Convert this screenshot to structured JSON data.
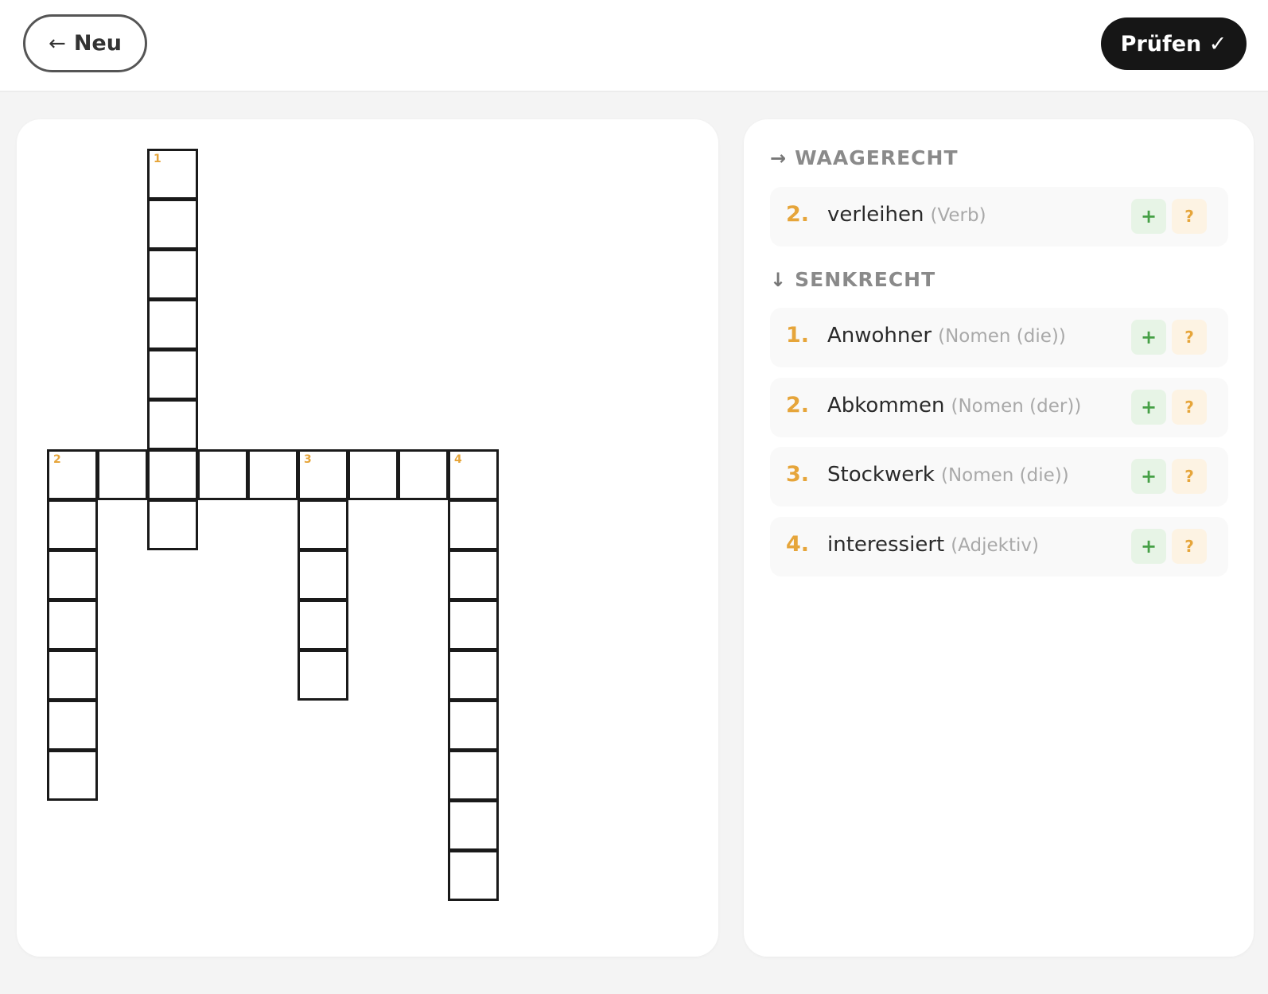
{
  "header": {
    "back_label": "Neu",
    "back_icon": "arrow-left-icon",
    "check_label": "Prüfen ✓"
  },
  "crossword": {
    "numbers": {
      "n1": "1",
      "n2": "2",
      "n3": "3",
      "n4": "4"
    }
  },
  "clues": {
    "across": {
      "heading": "WAAGERECHT",
      "icon": "arrow-right-icon",
      "items": [
        {
          "num": "2.",
          "word": "verleihen",
          "type": "(Verb)"
        }
      ]
    },
    "down": {
      "heading": "SENKRECHT",
      "icon": "arrow-down-icon",
      "items": [
        {
          "num": "1.",
          "word": "Anwohner",
          "type": "(Nomen (die))"
        },
        {
          "num": "2.",
          "word": "Abkommen",
          "type": "(Nomen (der))"
        },
        {
          "num": "3.",
          "word": "Stockwerk",
          "type": "(Nomen (die))"
        },
        {
          "num": "4.",
          "word": "interessiert",
          "type": "(Adjektiv)"
        }
      ]
    },
    "plus_label": "+",
    "hint_label": "?"
  },
  "colors": {
    "accent": "#e6a53a",
    "plus_green": "#46a046",
    "dark_button": "#161616"
  }
}
